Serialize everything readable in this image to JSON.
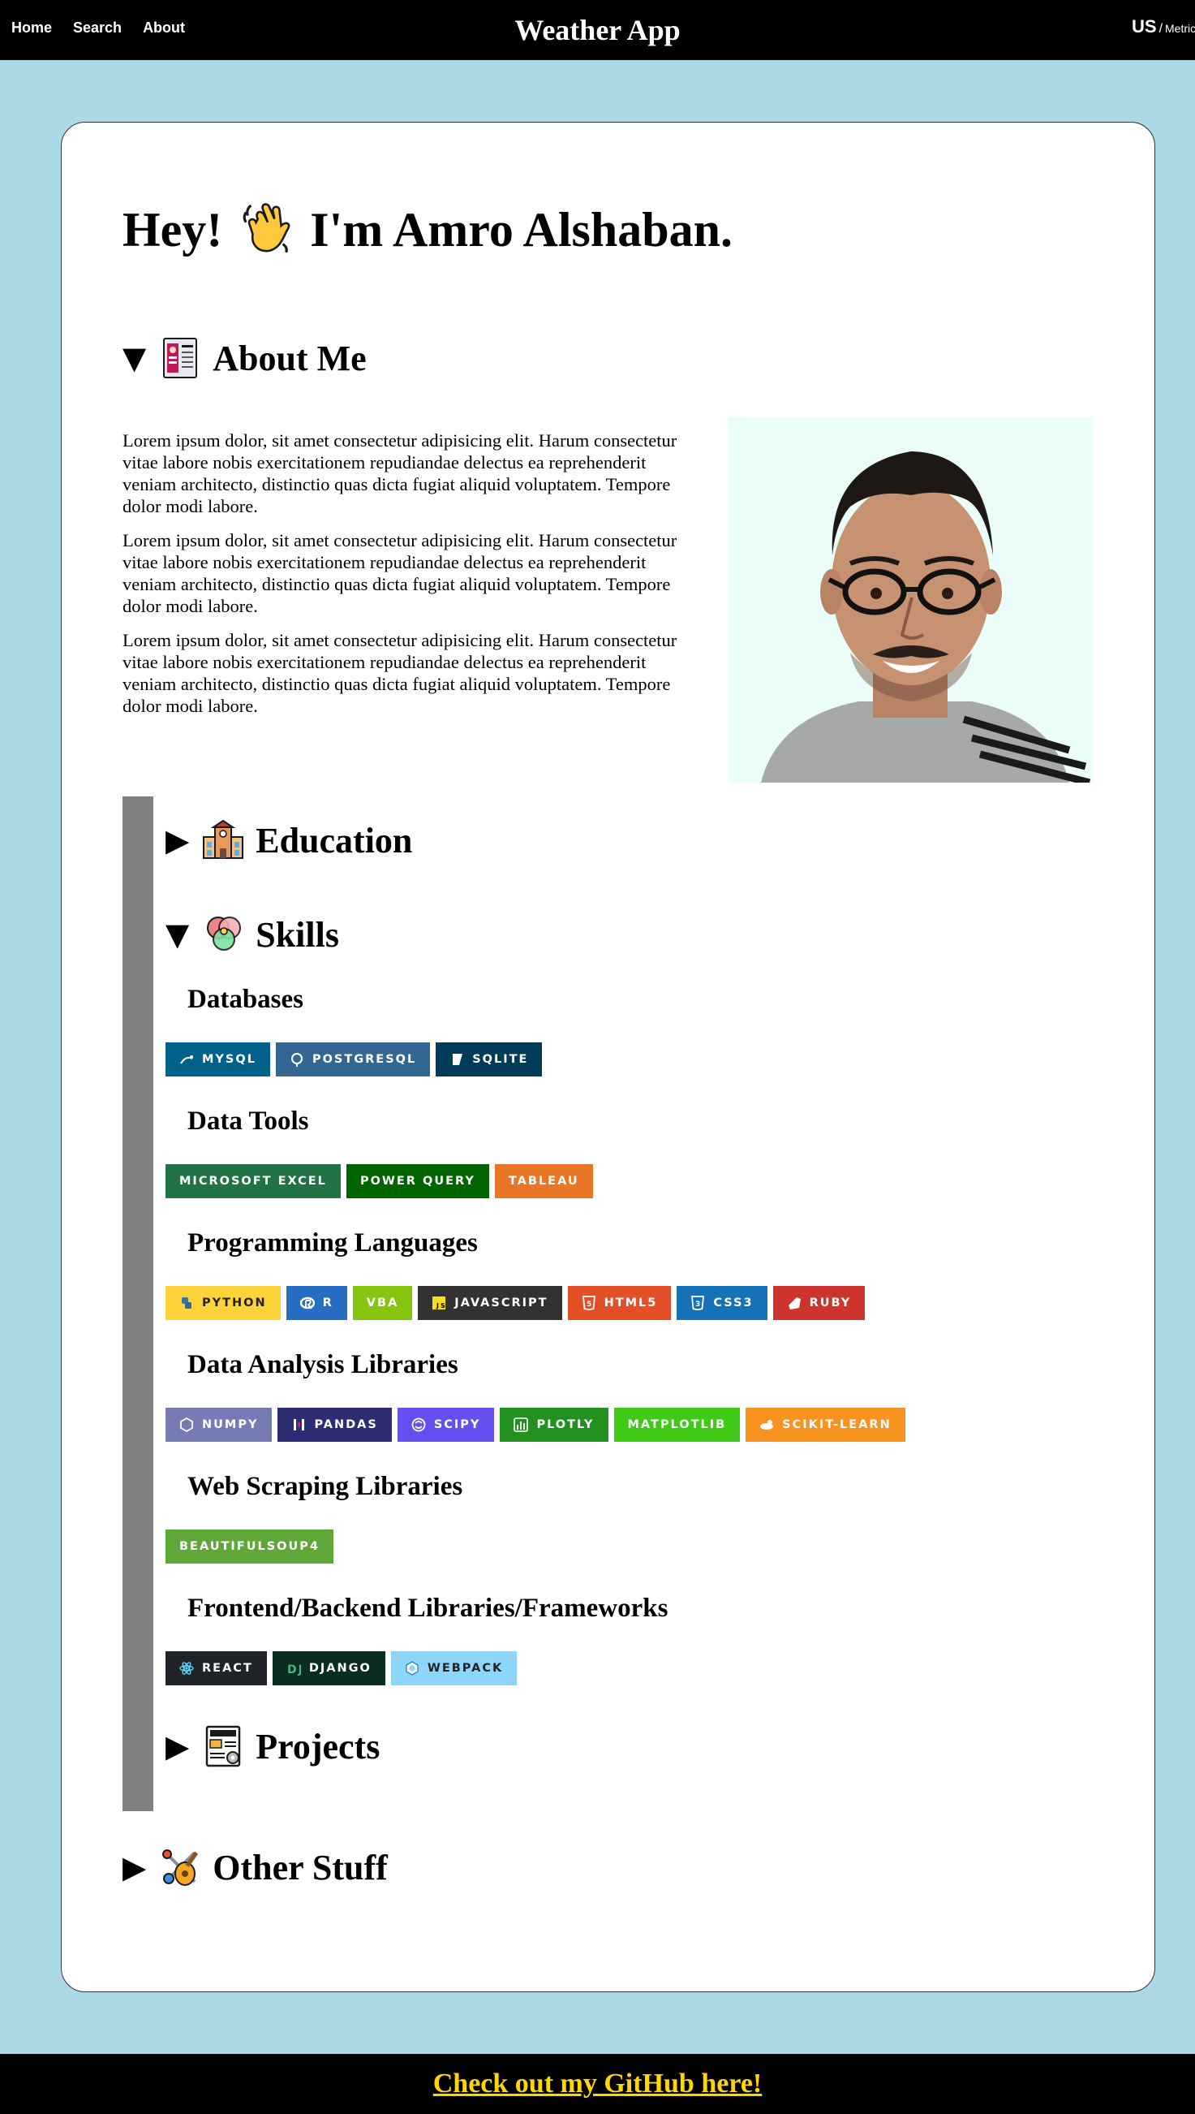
{
  "nav": {
    "links": [
      "Home",
      "Search",
      "About"
    ],
    "title": "Weather App",
    "unit_us": "US",
    "unit_sep": "/",
    "unit_metric": "Metric"
  },
  "hero": {
    "before": "Hey!",
    "after": "I'm Amro Alshaban."
  },
  "sections": {
    "about": {
      "marker": "▼",
      "label": "About Me"
    },
    "education": {
      "marker": "▶",
      "label": "Education"
    },
    "skills": {
      "marker": "▼",
      "label": "Skills"
    },
    "projects": {
      "marker": "▶",
      "label": "Projects"
    },
    "other": {
      "marker": "▶",
      "label": "Other Stuff"
    }
  },
  "about": {
    "paragraphs": [
      "Lorem ipsum dolor, sit amet consectetur adipisicing elit. Harum consectetur vitae labore nobis exercitationem repudiandae delectus ea reprehenderit veniam architecto, distinctio quas dicta fugiat aliquid voluptatem. Tempore dolor modi labore.",
      "Lorem ipsum dolor, sit amet consectetur adipisicing elit. Harum consectetur vitae labore nobis exercitationem repudiandae delectus ea reprehenderit veniam architecto, distinctio quas dicta fugiat aliquid voluptatem. Tempore dolor modi labore.",
      "Lorem ipsum dolor, sit amet consectetur adipisicing elit. Harum consectetur vitae labore nobis exercitationem repudiandae delectus ea reprehenderit veniam architecto, distinctio quas dicta fugiat aliquid voluptatem. Tempore dolor modi labore."
    ]
  },
  "skills": {
    "groups": [
      {
        "title": "Databases",
        "badges": [
          {
            "label": "MYSQL",
            "color": "#00618a",
            "icon": "mysql-icon"
          },
          {
            "label": "POSTGRESQL",
            "color": "#336791",
            "icon": "postgresql-icon"
          },
          {
            "label": "SQLITE",
            "color": "#003b57",
            "icon": "sqlite-icon"
          }
        ]
      },
      {
        "title": "Data Tools",
        "badges": [
          {
            "label": "MICROSOFT EXCEL",
            "color": "#217346",
            "icon": ""
          },
          {
            "label": "POWER QUERY",
            "color": "#006400",
            "icon": ""
          },
          {
            "label": "TABLEAU",
            "color": "#e97627",
            "icon": ""
          }
        ]
      },
      {
        "title": "Programming Languages",
        "badges": [
          {
            "label": "PYTHON",
            "color": "#ffd43b",
            "icon": "python-icon",
            "dark": true
          },
          {
            "label": "R",
            "color": "#276dc3",
            "icon": "r-icon"
          },
          {
            "label": "VBA",
            "color": "#86c40e",
            "icon": ""
          },
          {
            "label": "JAVASCRIPT",
            "color": "#323330",
            "icon": "javascript-icon"
          },
          {
            "label": "HTML5",
            "color": "#e34f26",
            "icon": "html5-icon"
          },
          {
            "label": "CSS3",
            "color": "#1572b6",
            "icon": "css3-icon"
          },
          {
            "label": "RUBY",
            "color": "#cc342d",
            "icon": "ruby-icon"
          }
        ]
      },
      {
        "title": "Data Analysis Libraries",
        "badges": [
          {
            "label": "NUMPY",
            "color": "#777bb3",
            "icon": "numpy-icon"
          },
          {
            "label": "PANDAS",
            "color": "#2c2d72",
            "icon": "pandas-icon"
          },
          {
            "label": "SCIPY",
            "color": "#654ff0",
            "icon": "scipy-icon"
          },
          {
            "label": "PLOTLY",
            "color": "#239120",
            "icon": "plotly-icon"
          },
          {
            "label": "MATPLOTLIB",
            "color": "#3fca17",
            "icon": ""
          },
          {
            "label": "SCIKIT-LEARN",
            "color": "#f7931e",
            "icon": "scikit-learn-icon"
          }
        ]
      },
      {
        "title": "Web Scraping Libraries",
        "badges": [
          {
            "label": "BEAUTIFULSOUP4",
            "color": "#5fa738",
            "icon": ""
          }
        ]
      },
      {
        "title": "Frontend/Backend Libraries/Frameworks",
        "badges": [
          {
            "label": "REACT",
            "color": "#20232a",
            "icon": "react-icon"
          },
          {
            "label": "DJANGO",
            "color": "#092e20",
            "icon": "django-icon"
          },
          {
            "label": "WEBPACK",
            "color": "#8dd6f9",
            "icon": "webpack-icon",
            "dark": true
          }
        ]
      }
    ]
  },
  "footer": {
    "link": "Check out my GitHub here!"
  }
}
